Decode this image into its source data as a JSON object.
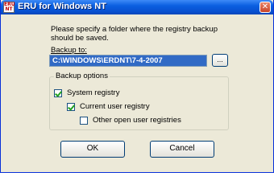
{
  "window": {
    "title": "ERU for Windows NT",
    "app_icon_lines": [
      "ERU",
      "NT"
    ],
    "close_glyph": "✕"
  },
  "dialog": {
    "instructions": "Please specify a folder where the registry backup should be saved.",
    "backup_label": "Backup to:",
    "backup_path": "C:\\WINDOWS\\ERDNT\\7-4-2007",
    "browse_label": "..."
  },
  "backup_options": {
    "title": "Backup options",
    "items": [
      {
        "label": "System registry",
        "checked": true
      },
      {
        "label": "Current user registry",
        "checked": true
      },
      {
        "label": "Other open user registries",
        "checked": false
      }
    ]
  },
  "buttons": {
    "ok_label": "OK",
    "cancel_label": "Cancel"
  },
  "colors": {
    "titlebar": "#0a5fe0",
    "dialog_bg": "#ece9d8",
    "selection": "#316ac5",
    "check": "#21a121"
  }
}
